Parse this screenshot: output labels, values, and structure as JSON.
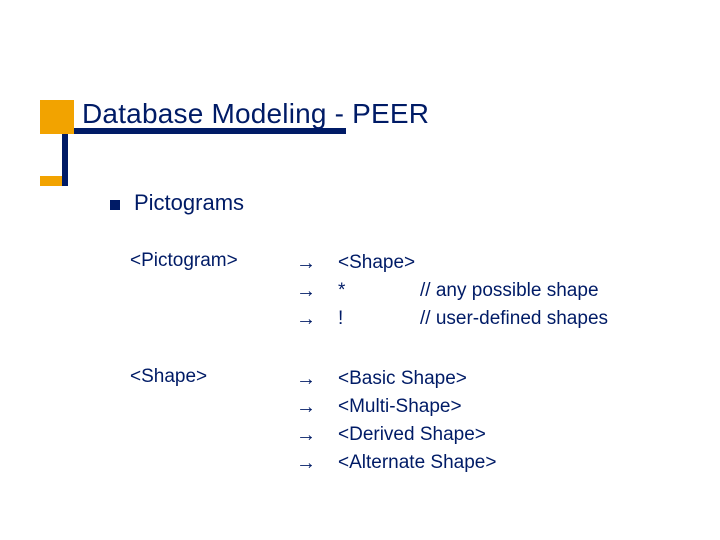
{
  "title": "Database Modeling - PEER",
  "bullet1": "Pictograms",
  "grammar": {
    "rules": [
      {
        "lhs": "<Pictogram>",
        "productions": [
          {
            "text": "<Shape>",
            "comment": ""
          },
          {
            "text": "*",
            "comment": "// any possible shape"
          },
          {
            "text": "!",
            "comment": "// user-defined shapes"
          }
        ]
      },
      {
        "lhs": "<Shape>",
        "productions": [
          {
            "text": "<Basic Shape>",
            "comment": ""
          },
          {
            "text": "<Multi-Shape>",
            "comment": ""
          },
          {
            "text": "<Derived Shape>",
            "comment": ""
          },
          {
            "text": "<Alternate Shape>",
            "comment": ""
          }
        ]
      }
    ]
  },
  "glyphs": {
    "arrow": "→"
  }
}
